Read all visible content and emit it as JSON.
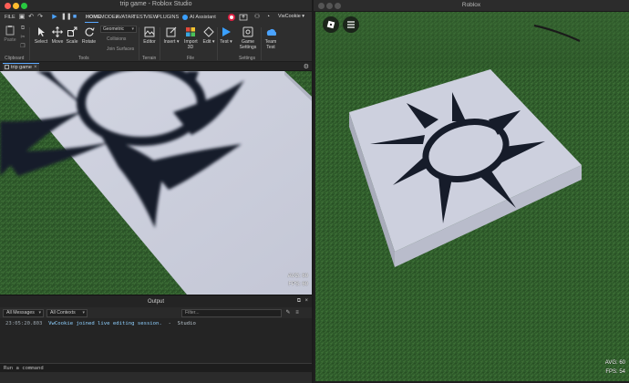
{
  "studio": {
    "window_title": "trip game - Roblox Studio",
    "menu": {
      "file": "FILE",
      "tabs": [
        "HOME",
        "MODEL",
        "AVATAR",
        "TEST",
        "VIEW",
        "PLUGINS"
      ],
      "ai_assistant": "AI Assistant",
      "user": "VwCookie"
    },
    "ribbon": {
      "paste": "Paste",
      "select": "Select",
      "move": "Move",
      "scale": "Scale",
      "rotate": "Rotate",
      "mode_dropdown": "Geometric",
      "collisions": "Collisions",
      "join_surfaces": "Join Surfaces",
      "editor": "Editor",
      "insert": "Insert",
      "import_3d": "Import 3D",
      "edit": "Edit",
      "test": "Test",
      "game_settings": "Game Settings",
      "team_test": "Team Test",
      "groups": {
        "clipboard": "Clipboard",
        "tools": "Tools",
        "terrain": "Terrain",
        "file": "File",
        "settings": "Settings"
      }
    },
    "doc_tab": "trip game",
    "viewport_stats": {
      "avg": "AVG: 60",
      "fps": "FPS: 60"
    },
    "output": {
      "title": "Output",
      "filter_messages": "All Messages",
      "filter_contexts": "All Contexts",
      "filter_placeholder": "Filter...",
      "log": {
        "time": "23:05:20.803",
        "message": "VwCookie joined live editing session.",
        "source": "Studio"
      },
      "command_placeholder": "Run a command"
    }
  },
  "player": {
    "window_title": "Roblox",
    "stats": {
      "avg": "AVG: 60",
      "fps": "FPS: 54"
    }
  },
  "colors": {
    "accent": "#5aa8ff",
    "grass": "#2f5a2b",
    "part": "#c9ccdb",
    "decal": "#161c2a"
  }
}
